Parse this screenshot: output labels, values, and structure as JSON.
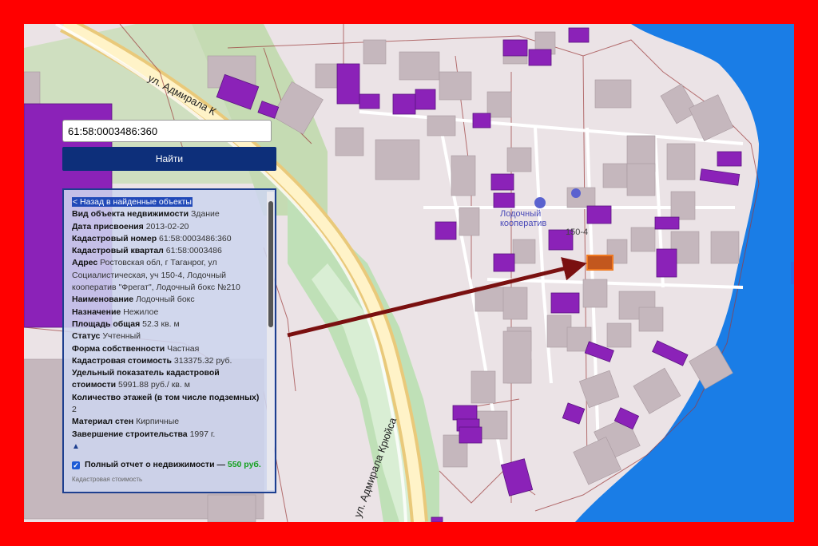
{
  "search": {
    "value": "61:58:0003486:360",
    "button_label": "Найти"
  },
  "info": {
    "back_link": "< Назад в найденные объекты",
    "rows": [
      {
        "label": "Вид объекта недвижимости",
        "value": "Здание"
      },
      {
        "label": "Дата присвоения",
        "value": "2013-02-20"
      },
      {
        "label": "Кадастровый номер",
        "value": "61:58:0003486:360"
      },
      {
        "label": "Кадастровый квартал",
        "value": "61:58:0003486"
      },
      {
        "label": "Адрес",
        "value": "Ростовская обл, г Таганрог, ул Социалистическая, уч 150-4, Лодочный кооператив \"Фрегат\", Лодочный бокс №210"
      },
      {
        "label": "Наименование",
        "value": "Лодочный бокс"
      },
      {
        "label": "Назначение",
        "value": "Нежилое"
      },
      {
        "label": "Площадь общая",
        "value": "52.3 кв. м"
      },
      {
        "label": "Статус",
        "value": "Учтенный"
      },
      {
        "label": "Форма собственности",
        "value": "Частная"
      },
      {
        "label": "Кадастровая стоимость",
        "value": "313375.32 руб."
      },
      {
        "label": "Удельный показатель кадастровой стоимости",
        "value": "5991.88 руб./ кв. м"
      },
      {
        "label": "Количество этажей (в том числе подземных)",
        "value": "2"
      },
      {
        "label": "Материал стен",
        "value": "Кирпичные"
      },
      {
        "label": "Завершение строительства",
        "value": "1997 г."
      }
    ],
    "expand_glyph": "▲",
    "report_label": "Полный отчет о недвижимости — ",
    "report_price": "550 руб.",
    "cut_text": "Кадастровая стоимость"
  },
  "map": {
    "street_1": "ул. Адмирала К",
    "street_2": "ул. Адмирала Крюйса",
    "poi_name": "Лодочный кооператив",
    "plot_number": "150-4",
    "colors": {
      "highlight": "#8b22b8",
      "selected": "#f07a22",
      "water": "#1a7de6",
      "frame": "#ff0000",
      "arrow": "#7a1010"
    }
  }
}
